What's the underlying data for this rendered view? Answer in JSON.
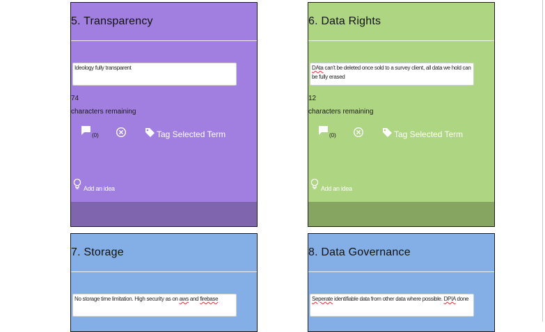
{
  "colors": {
    "purple": "#a17fe0",
    "purple_footer": "#7f65ad",
    "green": "#add582",
    "green_footer": "#85a561",
    "blue": "#84aee6"
  },
  "common": {
    "chars_remaining_label": "characters remaining",
    "comment_count": "(0)",
    "tag_label": "Tag Selected Term",
    "idea_label": "Add an idea"
  },
  "cards": [
    {
      "title": "5. Transparency",
      "text": "Ideology fully transparent",
      "count": "74"
    },
    {
      "title": "6. Data Rights",
      "text_part1": "DAta",
      "text_part2": " can't be deleted once sold to a survey client, all data we hold can be fully erased",
      "count": "12"
    },
    {
      "title": "7. Storage",
      "text_part1": "No storage time limitation. High security as on ",
      "text_part2": "aws",
      "text_part3": " and ",
      "text_part4": "firebase"
    },
    {
      "title": "8. Data Governance",
      "text_part1": "Seperate",
      "text_part2": " identifiable data from other data where possible. ",
      "text_part3": "DPIA",
      "text_part4": " done"
    }
  ]
}
